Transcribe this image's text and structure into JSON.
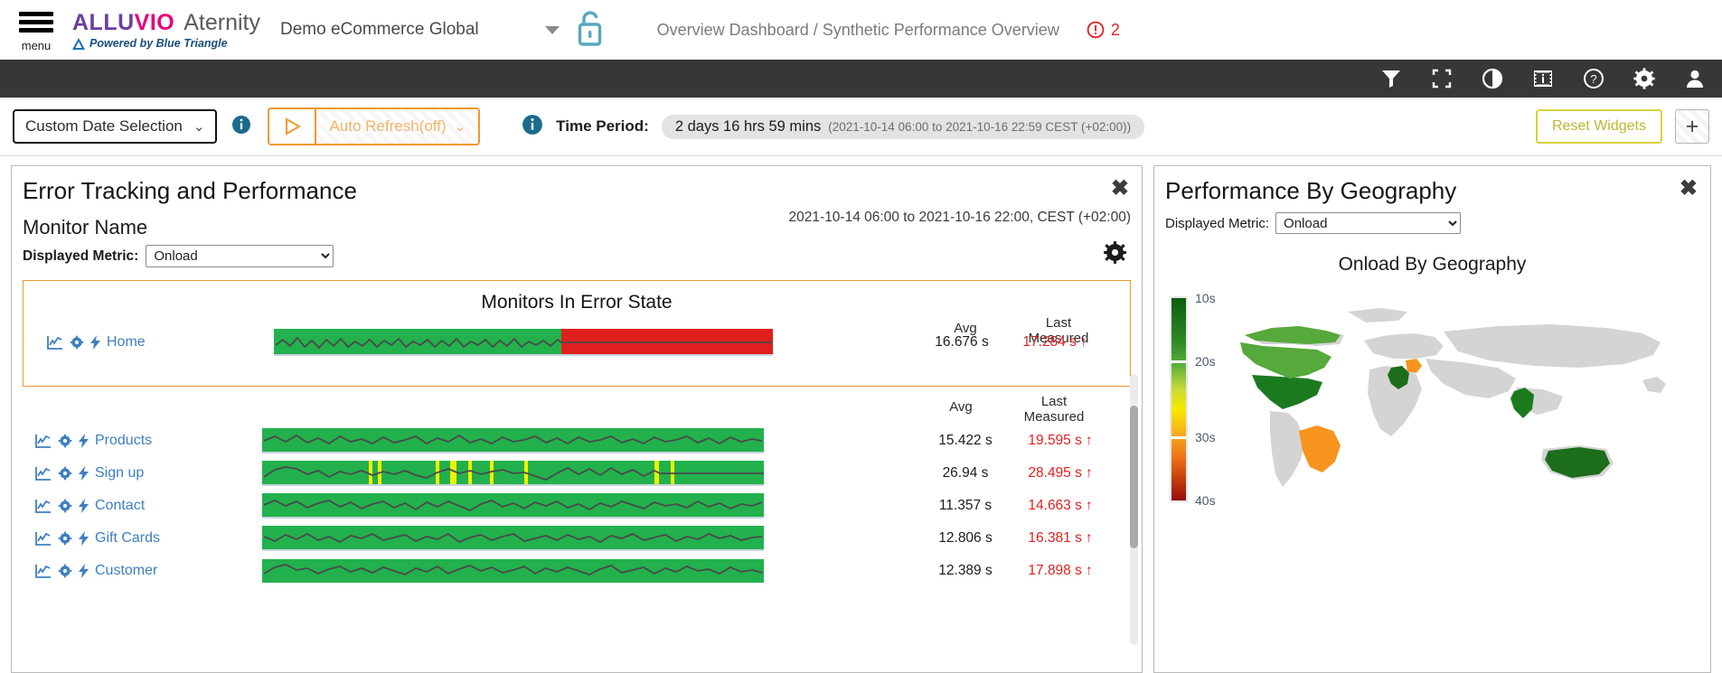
{
  "header": {
    "menu_label": "menu",
    "brand_alluvio_1": "ALLU",
    "brand_alluvio_2": "VIO",
    "brand_aternity": "Aternity",
    "powered_by": "Powered by Blue Triangle",
    "account": "Demo eCommerce Global",
    "breadcrumb": "Overview Dashboard / Synthetic Performance Overview",
    "error_count": "2",
    "icons": {
      "menu": "hamburger-menu-icon",
      "triangle": "blue-triangle-logo-icon",
      "account_caret": "chevron-down-icon",
      "lock": "unlocked-padlock-icon",
      "error": "error-circle-icon"
    }
  },
  "darkbar": {
    "items": [
      {
        "name": "filter-icon",
        "label": "Filter"
      },
      {
        "name": "fullscreen-icon",
        "label": "Fullscreen"
      },
      {
        "name": "contrast-icon",
        "label": "Contrast"
      },
      {
        "name": "info-panel-icon",
        "label": "Info Panel"
      },
      {
        "name": "help-icon",
        "label": "Help"
      },
      {
        "name": "settings-gear-icon",
        "label": "Settings"
      },
      {
        "name": "user-avatar-icon",
        "label": "User"
      }
    ]
  },
  "controlbar": {
    "date_selection": "Custom Date Selection",
    "auto_refresh": "Auto Refresh(off)",
    "time_period_label": "Time Period:",
    "time_period_duration": "2 days 16 hrs 59 mins",
    "time_period_range": "(2021-10-14 06:00 to 2021-10-16 22:59 CEST (+02:00))",
    "reset_widgets": "Reset Widgets",
    "add_widget": "+"
  },
  "widget_left": {
    "title": "Error Tracking and Performance",
    "close": "✖",
    "monitor_name_header": "Monitor Name",
    "displayed_metric_label": "Displayed Metric:",
    "displayed_metric_value": "Onload",
    "displayed_metric_options": [
      "Onload"
    ],
    "date_note": "2021-10-14 06:00 to 2021-10-16 22:00, CEST (+02:00)",
    "error_box_title": "Monitors In Error State",
    "col_avg": "Avg",
    "col_last": "Last",
    "col_last_2": "Measured",
    "error_rows": [
      {
        "name": "Home",
        "avg": "16.676 s",
        "last": "17.284 s",
        "trend": "↑"
      }
    ],
    "rows": [
      {
        "name": "Products",
        "avg": "15.422 s",
        "last": "19.595 s",
        "trend": "↑"
      },
      {
        "name": "Sign up",
        "avg": "26.94 s",
        "last": "28.495 s",
        "trend": "↑"
      },
      {
        "name": "Contact",
        "avg": "11.357 s",
        "last": "14.663 s",
        "trend": "↑"
      },
      {
        "name": "Gift Cards",
        "avg": "12.806 s",
        "last": "16.381 s",
        "trend": "↑"
      },
      {
        "name": "Customer",
        "avg": "12.389 s",
        "last": "17.898 s",
        "trend": "↑"
      }
    ]
  },
  "widget_right": {
    "title": "Performance By Geography",
    "close": "✖",
    "displayed_metric_label": "Displayed Metric:",
    "displayed_metric_value": "Onload",
    "displayed_metric_options": [
      "Onload"
    ],
    "chart_title": "Onload By Geography"
  },
  "chart_data": {
    "type": "heatmap",
    "title": "Onload By Geography",
    "unit": "s",
    "legend": {
      "position": "left",
      "ticks": [
        "10s",
        "20s",
        "30s",
        "40s"
      ],
      "tick_values": [
        10,
        20,
        30,
        40
      ],
      "colors": [
        "#0d6b14",
        "#3f9c35",
        "#93c83d",
        "#f4e400",
        "#f6a21d",
        "#e8591a",
        "#a31010"
      ]
    },
    "regions": [
      {
        "name": "United States",
        "value": 12,
        "color": "#1c7a1e"
      },
      {
        "name": "Canada",
        "value": 17,
        "color": "#56a93b"
      },
      {
        "name": "Brazil",
        "value": 31,
        "color": "#f6941d"
      },
      {
        "name": "France",
        "value": 11,
        "color": "#1c6e1a"
      },
      {
        "name": "Germany",
        "value": 30,
        "color": "#f6941d"
      },
      {
        "name": "India",
        "value": 12,
        "color": "#1c7a1e"
      },
      {
        "name": "Australia",
        "value": 11,
        "color": "#1c7a1e"
      }
    ],
    "unhighlighted_color": "#d4d4d4"
  },
  "sparkline_data": {
    "type": "line",
    "description": "Per-monitor onload sparkline bands. Green band = OK, red band = error state, yellow marks = warnings.",
    "series": [
      {
        "name": "Home",
        "band": "green",
        "error_band": "red",
        "error_start_pct": 57
      },
      {
        "name": "Products",
        "band": "green",
        "error_band": null
      },
      {
        "name": "Sign up",
        "band": "green",
        "error_band": null,
        "warning_marks_pct": [
          22,
          24,
          35,
          38,
          40,
          45,
          53,
          78,
          83
        ]
      },
      {
        "name": "Contact",
        "band": "green",
        "error_band": null
      },
      {
        "name": "Gift Cards",
        "band": "green",
        "error_band": null
      },
      {
        "name": "Customer",
        "band": "green",
        "error_band": null
      }
    ]
  }
}
